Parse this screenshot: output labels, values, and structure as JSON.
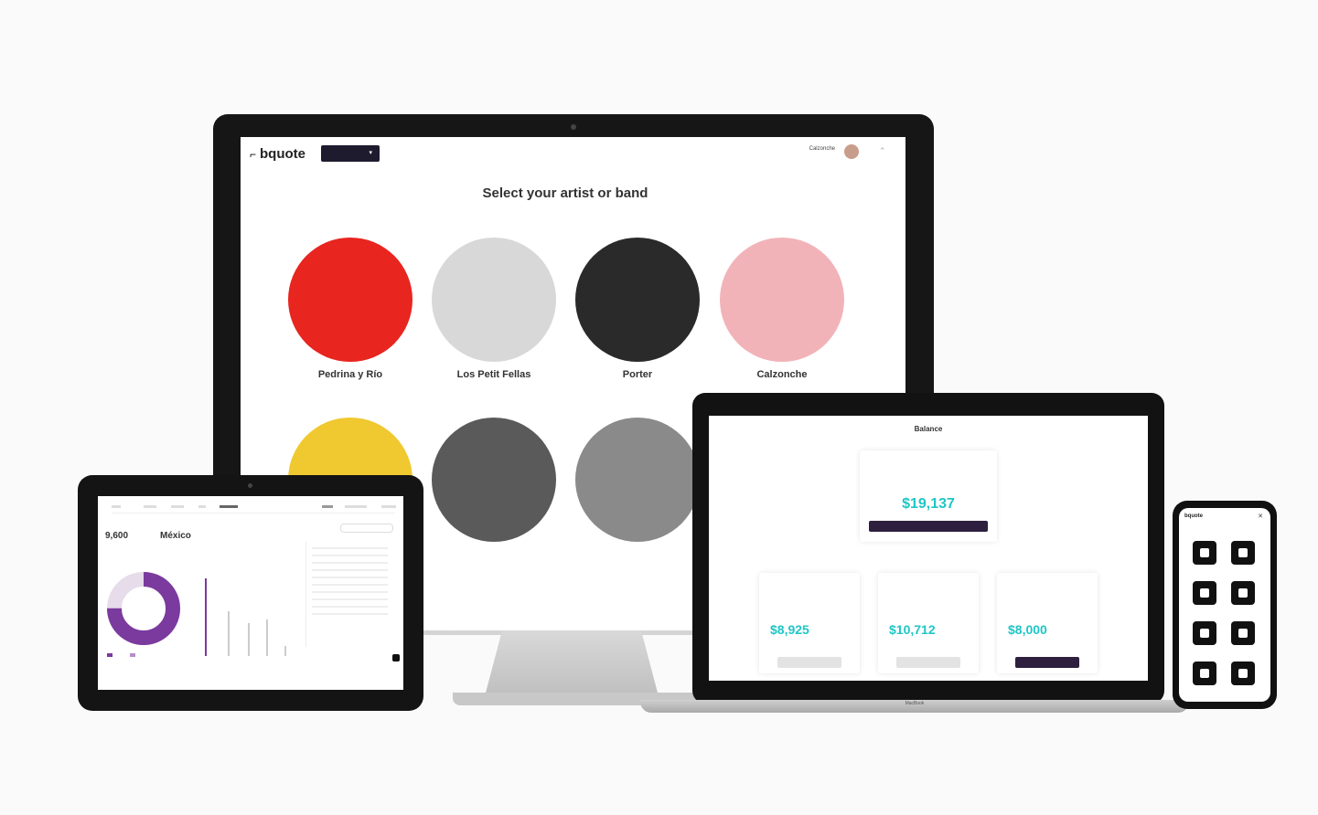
{
  "colors": {
    "accent": "#1fc6c6",
    "dark": "#1e1b2e",
    "purple": "#7b3a9e"
  },
  "desktop": {
    "logo": "bquote",
    "selector": "",
    "user": {
      "name": "Calzonche",
      "role": ""
    },
    "title": "Select your artist or band",
    "artists": [
      {
        "name": "Pedrina y Río",
        "role": "",
        "color": "#e8251f"
      },
      {
        "name": "Los Petit Fellas",
        "role": "",
        "color": "#d8d8d8"
      },
      {
        "name": "Porter",
        "role": "",
        "color": "#2a2a2a"
      },
      {
        "name": "Calzonche",
        "role": "",
        "color": "#f2b3b8"
      },
      {
        "name": "",
        "role": "",
        "color": "#f0c830"
      },
      {
        "name": "",
        "role": "",
        "color": "#5a5a5a"
      },
      {
        "name": "",
        "role": "",
        "color": "#8a8a8a"
      }
    ]
  },
  "laptop": {
    "title": "Balance",
    "main_card": {
      "label": "",
      "tag": "",
      "amount": "$19,137",
      "currency": "",
      "button": ""
    },
    "cards": [
      {
        "label": "",
        "tag": "",
        "amount": "$8,925",
        "currency": "",
        "button": ""
      },
      {
        "label": "",
        "tag": "",
        "amount": "$10,712",
        "currency": "",
        "button": ""
      },
      {
        "label": "",
        "tag": "",
        "amount": "$8,000",
        "currency": "",
        "button": ""
      }
    ],
    "brand": "MacBook"
  },
  "tablet": {
    "stat1": "9,600",
    "stat2": "México",
    "donut_value": 0.75,
    "bars": [
      0.95,
      0.55,
      0.4,
      0.45,
      0.12
    ]
  },
  "phone": {
    "logo": "bquote",
    "title": ""
  }
}
